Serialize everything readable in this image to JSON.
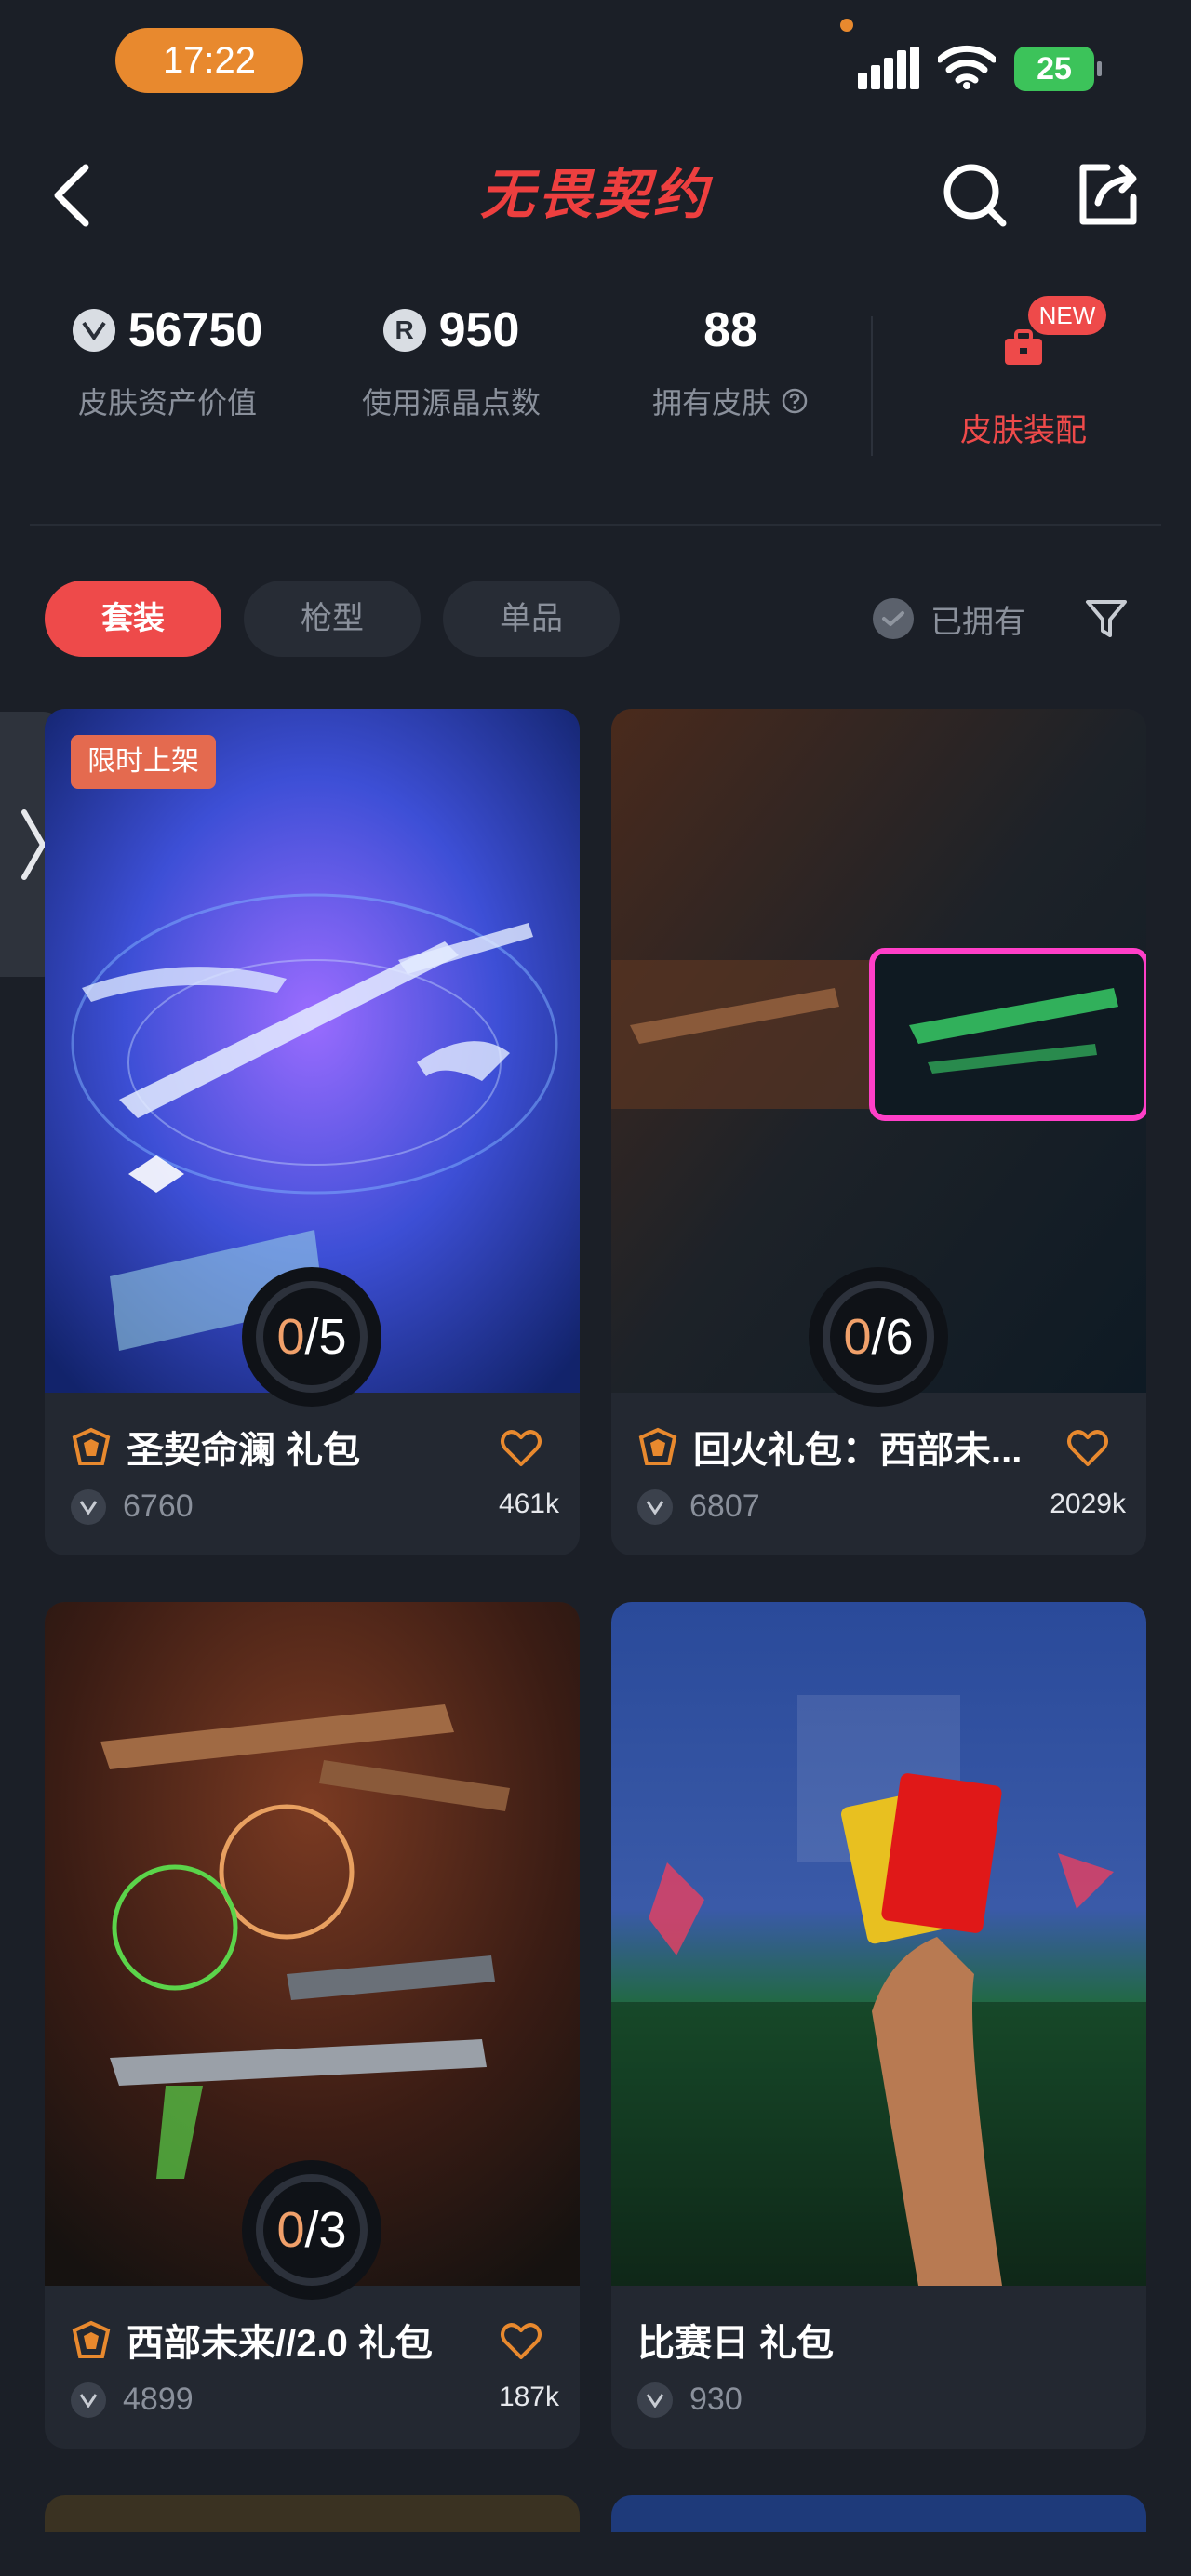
{
  "status_bar": {
    "time": "17:22",
    "battery": "25"
  },
  "header": {
    "title": "无畏契约"
  },
  "stats": {
    "asset_value": {
      "value": "56750",
      "label": "皮肤资产价值"
    },
    "crystal_points": {
      "value": "950",
      "label": "使用源晶点数",
      "icon_text": "R"
    },
    "owned_skins": {
      "value": "88",
      "label": "拥有皮肤"
    },
    "equip": {
      "label": "皮肤装配",
      "badge": "NEW"
    }
  },
  "filters": {
    "chips": [
      "套装",
      "枪型",
      "单品"
    ],
    "active_index": 0,
    "owned_label": "已拥有"
  },
  "cards": [
    {
      "name": "圣契命澜 礼包",
      "price": "6760",
      "likes": "461k",
      "owned": "0",
      "total": "5",
      "badge": "限时上架",
      "has_tier": true,
      "has_heart": true
    },
    {
      "name": "回火礼包：西部未...",
      "price": "6807",
      "likes": "2029k",
      "owned": "0",
      "total": "6",
      "badge": "",
      "has_tier": true,
      "has_heart": true
    },
    {
      "name": "西部未来//2.0 礼包",
      "price": "4899",
      "likes": "187k",
      "owned": "0",
      "total": "3",
      "badge": "",
      "has_tier": true,
      "has_heart": true
    },
    {
      "name": "比赛日 礼包",
      "price": "930",
      "likes": "",
      "owned": "",
      "total": "",
      "badge": "",
      "has_tier": false,
      "has_heart": false
    }
  ],
  "colors": {
    "accent": "#ee4a4a",
    "orange": "#e8892e",
    "background": "#1b1f27",
    "card": "#232831"
  }
}
